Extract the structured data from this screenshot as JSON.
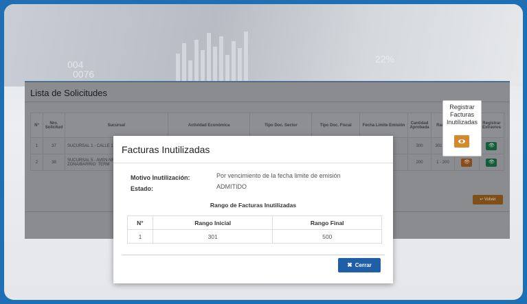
{
  "panel": {
    "title": "Lista de Solicitudes",
    "columns": [
      "N°",
      "Nro. Solicitud",
      "Sucursal",
      "Actividad Económica",
      "Tipo Doc. Sector",
      "Tipo Doc. Fiscal",
      "Fecha Limite Emisión",
      "Cantidad Aprobada",
      "Rango",
      "",
      "Registrar Extravios"
    ],
    "rows": [
      {
        "n": "1",
        "nro": "37",
        "sucursal": "SUCURSAL 1 - CALLE 167 ZONA/BARRIO: C",
        "cantidad": "300",
        "rango": "301 - 60"
      },
      {
        "n": "2",
        "nro": "38",
        "sucursal": "SUCURSAL 5 - AVEN NRO. 835 EDIF. MULT ZONA/BARRIO: TERM",
        "cantidad": "200",
        "rango": "1 - 200"
      }
    ],
    "volver_label": "Volver"
  },
  "tooltip": {
    "text": "Registrar Facturas Inutilizadas"
  },
  "modal": {
    "title": "Facturas Inutilizadas",
    "motivo_label": "Motivo Inutilización:",
    "motivo_value": "Por vencimiento de la fecha limite de emisión",
    "estado_label": "Estado:",
    "estado_value": "ADMITIDO",
    "range_title": "Rango de Facturas Inutilizadas",
    "table_headers": [
      "N°",
      "Rango Inicial",
      "Rango Final"
    ],
    "table_rows": [
      [
        "1",
        "301",
        "500"
      ]
    ],
    "close_label": "Cerrar"
  },
  "hero": {
    "numbers": [
      "004",
      "0076",
      "22%"
    ]
  },
  "colors": {
    "primary": "#1f5fa8",
    "warning": "#d4892b",
    "success": "#1e8e57",
    "frame": "#1f6fb5"
  }
}
